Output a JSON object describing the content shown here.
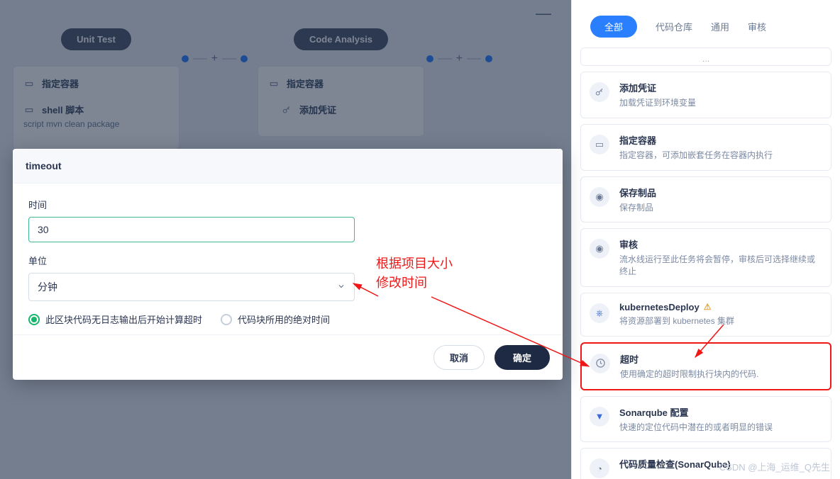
{
  "canvas": {
    "minus": "—",
    "stages": [
      {
        "name": "Unit Test",
        "steps": [
          {
            "title": "指定容器"
          },
          {
            "title": "shell 脚本",
            "sub": "script   mvn clean package"
          }
        ]
      },
      {
        "name": "Code Analysis",
        "steps": [
          {
            "title": "指定容器"
          },
          {
            "title": "添加凭证"
          }
        ]
      }
    ]
  },
  "modal": {
    "title": "timeout",
    "time_label": "时间",
    "time_value": "30",
    "unit_label": "单位",
    "unit_value": "分钟",
    "radio1": "此区块代码无日志输出后开始计算超时",
    "radio2": "代码块所用的绝对时间",
    "cancel": "取消",
    "ok": "确定"
  },
  "annotation": {
    "line1": "根据项目大小",
    "line2": "修改时间"
  },
  "sidebar": {
    "tabs": {
      "all": "全部",
      "repo": "代码仓库",
      "general": "通用",
      "review": "审核"
    },
    "cards": {
      "cred": {
        "title": "添加凭证",
        "desc": "加载凭证到环境变量"
      },
      "cont": {
        "title": "指定容器",
        "desc": "指定容器，可添加嵌套任务在容器内执行"
      },
      "art": {
        "title": "保存制品",
        "desc": "保存制品"
      },
      "rev": {
        "title": "审核",
        "desc": "流水线运行至此任务将会暂停，审核后可选择继续或终止"
      },
      "kube": {
        "title": "kubernetesDeploy",
        "warn": "⚠",
        "desc": "将资源部署到 kubernetes 集群"
      },
      "timeout": {
        "title": "超时",
        "desc": "使用确定的超时限制执行块内的代码."
      },
      "sonar": {
        "title": "Sonarqube 配置",
        "desc": "快速的定位代码中潜在的或者明显的错误"
      },
      "quality": {
        "title": "代码质量检查(SonarQube)"
      }
    }
  },
  "watermark": "CSDN @上海_运维_Q先生"
}
